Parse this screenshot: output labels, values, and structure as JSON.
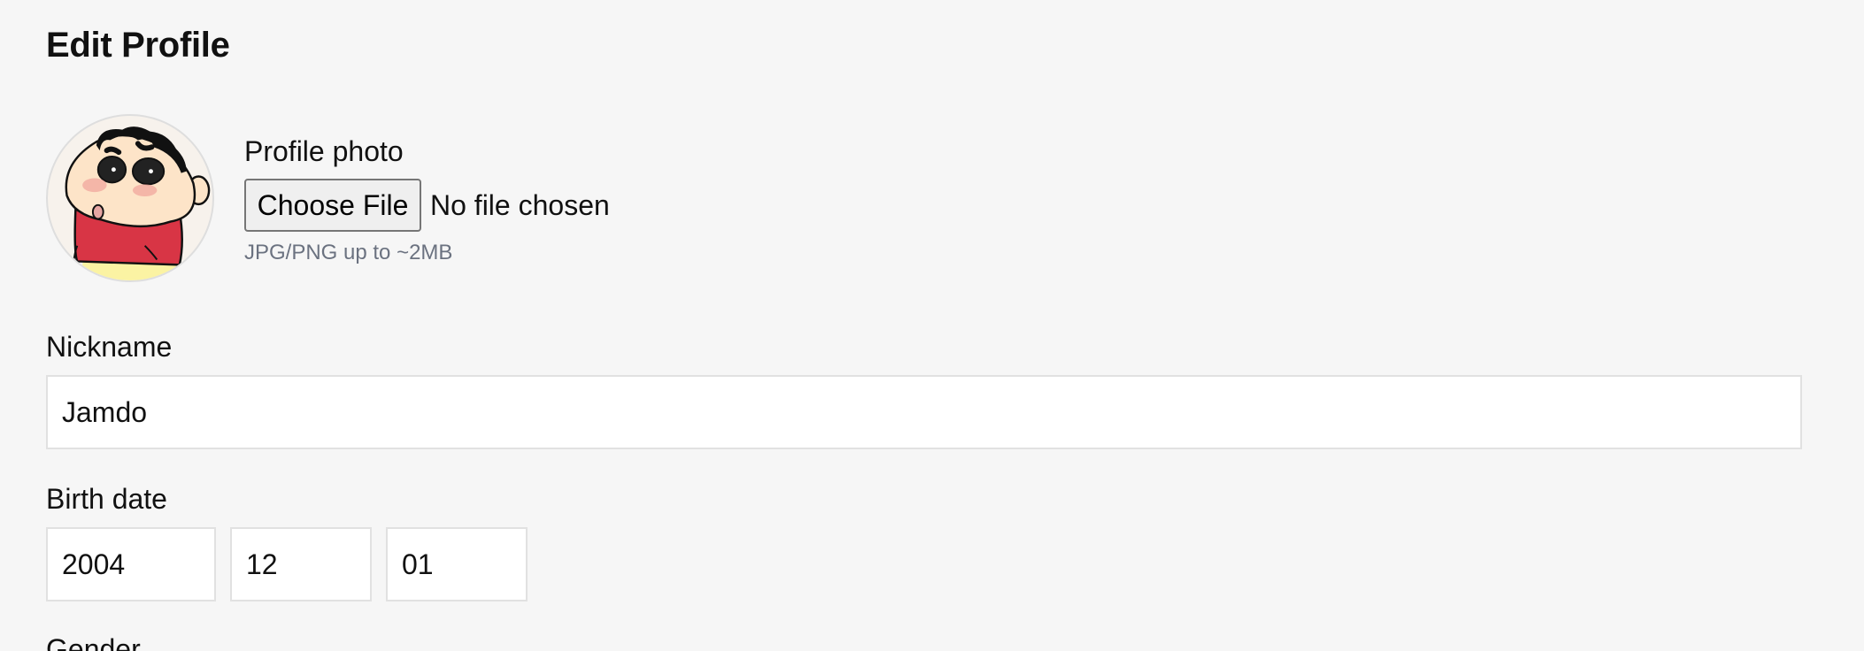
{
  "page": {
    "title": "Edit Profile"
  },
  "profile_photo": {
    "label": "Profile photo",
    "choose_button_label": "Choose File",
    "file_status": "No file chosen",
    "hint": "JPG/PNG up to ~2MB",
    "avatar_icon": "cartoon-avatar"
  },
  "nickname": {
    "label": "Nickname",
    "value": "Jamdo"
  },
  "birth_date": {
    "label": "Birth date",
    "year": "2004",
    "month": "12",
    "day": "01"
  },
  "gender": {
    "label": "Gender"
  }
}
